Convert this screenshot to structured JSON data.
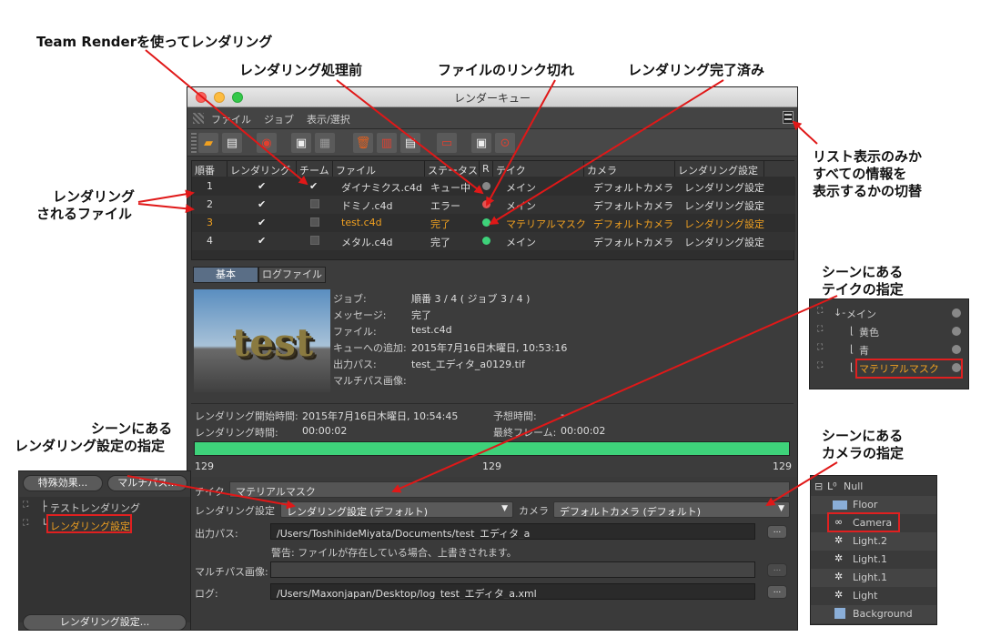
{
  "annotations": {
    "team_render": "Team Renderを使ってレンダリング",
    "before_render": "レンダリング処理前",
    "link_broken": "ファイルのリンク切れ",
    "render_done": "レンダリング完了済み",
    "list_toggle": [
      "リスト表示のみか",
      "すべての情報を",
      "表示するかの切替"
    ],
    "files_rendered": [
      "レンダリング",
      "されるファイル"
    ],
    "take_spec": [
      "シーンにある",
      "テイクの指定"
    ],
    "render_setting_spec": [
      "シーンにある",
      "レンダリング設定の指定"
    ],
    "camera_spec": [
      "シーンにある",
      "カメラの指定"
    ]
  },
  "window": {
    "title": "レンダーキュー",
    "menu": [
      "ファイル",
      "ジョブ",
      "表示/選択"
    ]
  },
  "table": {
    "headers": [
      "順番",
      "レンダリング",
      "チーム",
      "ファイル",
      "ステータス",
      "R",
      "テイク",
      "カメラ",
      "レンダリング設定"
    ],
    "rows": [
      {
        "order": "1",
        "render": "✔",
        "team": "✔",
        "file": "ダイナミクス.c4d",
        "status": "キュー中",
        "r": "gray",
        "take": "メイン",
        "camera": "デフォルトカメラ",
        "setting": "レンダリング設定"
      },
      {
        "order": "2",
        "render": "✔",
        "team": "",
        "file": "ドミノ.c4d",
        "status": "エラー",
        "r": "red",
        "take": "メイン",
        "camera": "デフォルトカメラ",
        "setting": "レンダリング設定"
      },
      {
        "order": "3",
        "render": "✔",
        "team": "",
        "file": "test.c4d",
        "status": "完了",
        "r": "green",
        "take": "マテリアルマスク",
        "camera": "デフォルトカメラ",
        "setting": "レンダリング設定"
      },
      {
        "order": "4",
        "render": "✔",
        "team": "",
        "file": "メタル.c4d",
        "status": "完了",
        "r": "green",
        "take": "メイン",
        "camera": "デフォルトカメラ",
        "setting": "レンダリング設定"
      }
    ]
  },
  "tabs": [
    "基本",
    "ログファイル"
  ],
  "preview_text": "test",
  "info": {
    "job_label": "ジョブ:",
    "job": "順番 3 / 4 ( ジョブ 3 / 4 )",
    "message_label": "メッセージ:",
    "message": "完了",
    "file_label": "ファイル:",
    "file": "test.c4d",
    "added_label": "キューへの追加:",
    "added": "2015年7月16日木曜日, 10:53:16",
    "output_label": "出力パス:",
    "output": "test_エディタ_a0129.tif",
    "multipass_label": "マルチパス画像:"
  },
  "timing": {
    "start_label": "レンダリング開始時間:",
    "start": "2015年7月16日木曜日, 10:54:45",
    "duration_label": "レンダリング時間:",
    "duration": "00:00:02",
    "estimate_label": "予想時間:",
    "estimate": "-",
    "last_frame_label": "最終フレーム:",
    "last_frame": "00:00:02",
    "progress": 1.0,
    "frame_left": "129",
    "frame_mid": "129",
    "frame_right": "129"
  },
  "settings": {
    "take_label": "テイク",
    "take": "マテリアルマスク",
    "render_setting_label": "レンダリング設定",
    "render_setting": "レンダリング設定 (デフォルト)",
    "camera_label": "カメラ",
    "camera": "デフォルトカメラ (デフォルト)",
    "output_label": "出力パス:",
    "output": "/Users/ToshihideMiyata/Documents/test_エディタ_a",
    "warning": "警告: ファイルが存在している場合、上書きされます。",
    "multipass_label": "マルチパス画像:",
    "multipass": "",
    "log_label": "ログ:",
    "log": "/Users/Maxonjapan/Desktop/log_test_エディタ_a.xml",
    "browse": "..."
  },
  "take_panel": [
    "メイン",
    "黄色",
    "青",
    "マテリアルマスク"
  ],
  "render_panel": {
    "btn_effects": "特殊効果...",
    "btn_multipass": "マルチパス...",
    "items": [
      "テストレンダリング",
      "レンダリング設定"
    ],
    "bottom_btn": "レンダリング設定..."
  },
  "camera_panel": [
    "Null",
    "Floor",
    "Camera",
    "Light.2",
    "Light.1",
    "Light.1",
    "Light",
    "Background"
  ],
  "colors": {
    "highlight": "#f0a020",
    "progress": "#3ed27a",
    "arrow": "#e01818"
  }
}
